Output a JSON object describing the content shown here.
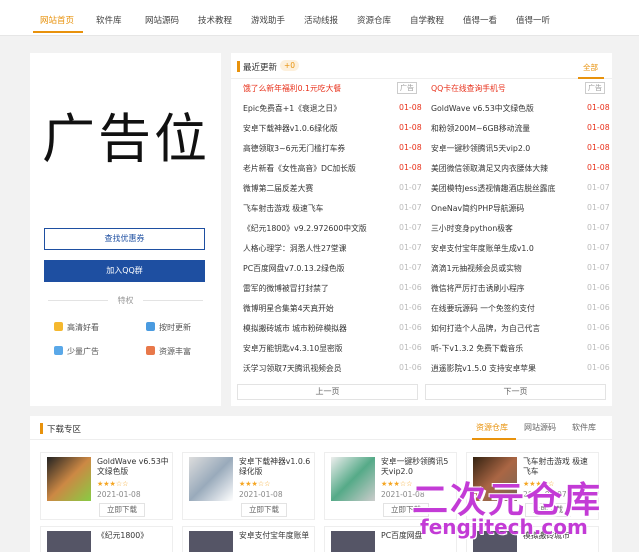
{
  "nav": {
    "items": [
      "网站首页",
      "软件库",
      "网站源码",
      "技术教程",
      "游戏助手",
      "活动线报",
      "资源仓库",
      "自学教程",
      "值得一看",
      "值得一听"
    ],
    "active_index": 0,
    "accent": "#e8920c"
  },
  "sidebar": {
    "ad_text": "广告位",
    "btn_coupon": "查找优惠券",
    "btn_qq": "加入QQ群",
    "features_title": "特权",
    "features": [
      "高清好看",
      "按时更新",
      "少量广告",
      "资源丰富"
    ],
    "brand_blue": "#1e4fa1"
  },
  "recent": {
    "title": "最近更新",
    "count": "+0",
    "all_label": "全部",
    "ad_tag": "广告",
    "left_col": [
      {
        "title": "饿了么新年福利0.1元吃大餐",
        "date": "",
        "ad": true,
        "hl": true
      },
      {
        "title": "Epic免费喜+1《衰退之日》",
        "date": "01-08",
        "red": true
      },
      {
        "title": "安卓下载神器v1.0.6绿化版",
        "date": "01-08",
        "red": true
      },
      {
        "title": "高德领取3~6元无门槛打车券",
        "date": "01-08",
        "red": true
      },
      {
        "title": "老片新看《女性高音》DC加长版",
        "date": "01-08",
        "red": true
      },
      {
        "title": "微博第二届反差大赛",
        "date": "01-07"
      },
      {
        "title": "飞车射击游戏 极速飞车",
        "date": "01-07"
      },
      {
        "title": "《纪元1800》v9.2.972600中文版",
        "date": "01-07"
      },
      {
        "title": "人格心理学：洞悉人性27堂课",
        "date": "01-07"
      },
      {
        "title": "PC百度网盘v7.0.13.2绿色版",
        "date": "01-07"
      },
      {
        "title": "雷军的微博被冒打封禁了",
        "date": "01-06"
      },
      {
        "title": "微博明星合集第4天真开始",
        "date": "01-06"
      },
      {
        "title": "模拟搬砖城市 城市粉碎模拟器",
        "date": "01-06"
      },
      {
        "title": "安卓万能钥匙v4.3.10显密版",
        "date": "01-06"
      },
      {
        "title": "沃学习领取7天腾讯视频会员",
        "date": "01-06"
      }
    ],
    "right_col": [
      {
        "title": "QQ卡在线查询手机号",
        "date": "",
        "ad": true,
        "hl": true
      },
      {
        "title": "GoldWave v6.53中文绿色版",
        "date": "01-08",
        "red": true
      },
      {
        "title": "和粉领200M~6GB移动流量",
        "date": "01-08",
        "red": true
      },
      {
        "title": "安卓一键秒领腾讯5天vip2.0",
        "date": "01-08",
        "red": true
      },
      {
        "title": "美团微信领取满足又内衣腰体大辣",
        "date": "01-08",
        "red": true
      },
      {
        "title": "美团模特Jess透视情趣酒店脱丝露底",
        "date": "01-07"
      },
      {
        "title": "OneNav简约PHP导航源码",
        "date": "01-07"
      },
      {
        "title": "三小时变身python极客",
        "date": "01-07"
      },
      {
        "title": "安卓支付宝年度账单生成v1.0",
        "date": "01-07"
      },
      {
        "title": "滴滴1元抽视频会员或实物",
        "date": "01-07"
      },
      {
        "title": "微信将严厉打击诱刷小程序",
        "date": "01-06"
      },
      {
        "title": "在线要玩源码 一个免签约支付",
        "date": "01-06"
      },
      {
        "title": "如何打造个人品牌，为自己代言",
        "date": "01-06"
      },
      {
        "title": "听-下v1.3.2 免费下载音乐",
        "date": "01-06"
      },
      {
        "title": "逍遥影院v1.5.0 支持安卓苹果",
        "date": "01-06"
      }
    ],
    "prev_label": "上一页",
    "next_label": "下一页"
  },
  "download": {
    "title": "下载专区",
    "tabs": [
      "资源仓库",
      "网站源码",
      "软件库"
    ],
    "active_tab": 0,
    "cards": [
      {
        "title": "GoldWave v6.53中文绿色版",
        "stars": "★★★☆☆",
        "date": "2021-01-08",
        "btn": "立即下载"
      },
      {
        "title": "安卓下载神器v1.0.6绿化版",
        "stars": "★★★☆☆",
        "date": "2021-01-08",
        "btn": "立即下载"
      },
      {
        "title": "安卓一键秒领腾讯5天vip2.0",
        "stars": "★★★☆☆",
        "date": "2021-01-08",
        "btn": "立即下载"
      },
      {
        "title": "飞车射击游戏 极速飞车",
        "stars": "★★★☆☆",
        "date": "2021-01-07",
        "btn": "立即下载"
      }
    ],
    "row2": [
      "《纪元1800》",
      "安卓支付宝年度账单",
      "PC百度网盘",
      "模拟搬砖城市"
    ]
  },
  "watermark": {
    "line1": "二次元仓库",
    "line2": "fengjitech.com",
    "color": "#c33bd6"
  }
}
